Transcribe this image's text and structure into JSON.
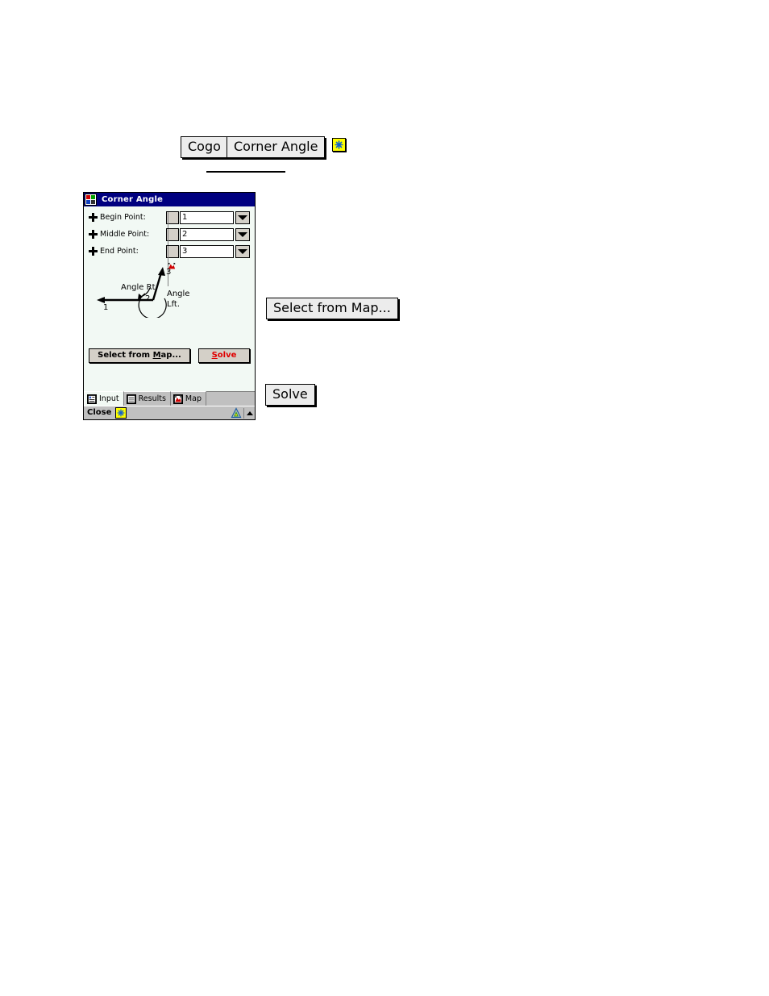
{
  "doc_callouts": {
    "cogo_button": "Cogo",
    "corner_angle_button": "Corner Angle",
    "star_icon_name": "star-icon",
    "select_from_map_button": "Select from Map...",
    "solve_button": "Solve"
  },
  "dialog": {
    "title": "Corner Angle",
    "title_icon_name": "cogo-app-icon",
    "colors": {
      "titlebar": "#000080",
      "body": "#f2f9f4",
      "chrome": "#c0c0c0",
      "button_face": "#d4d0c8",
      "solve_text": "#e00000",
      "star_yellow": "#ffff00"
    },
    "fields": [
      {
        "label": "Begin Point:",
        "value": "1",
        "pick_icon_name": "pick-from-map-icon"
      },
      {
        "label": "Middle Point:",
        "value": "2",
        "pick_icon_name": "pick-from-map-icon"
      },
      {
        "label": "End Point:",
        "value": "3",
        "pick_icon_name": "pick-from-map-icon"
      }
    ],
    "diagram": {
      "point_begin": "1",
      "point_middle": "2",
      "point_end": "3",
      "label_right": "Angle Rt",
      "label_left_1": "Angle",
      "label_left_2": "Lft."
    },
    "actions": {
      "select_from_map": "Select from Map...",
      "select_from_map_accel": "M",
      "solve": "Solve",
      "solve_accel": "S"
    },
    "tabs": [
      {
        "label": "Input",
        "icon": "input-form-icon",
        "active": true
      },
      {
        "label": "Results",
        "icon": "results-list-icon",
        "active": false
      },
      {
        "label": "Map",
        "icon": "map-icon",
        "active": false
      }
    ],
    "command_bar": {
      "close_label": "Close",
      "close_icon_name": "star-icon",
      "sip_icon_name": "input-panel-icon",
      "sip_arrow_name": "chevron-up-icon"
    }
  }
}
